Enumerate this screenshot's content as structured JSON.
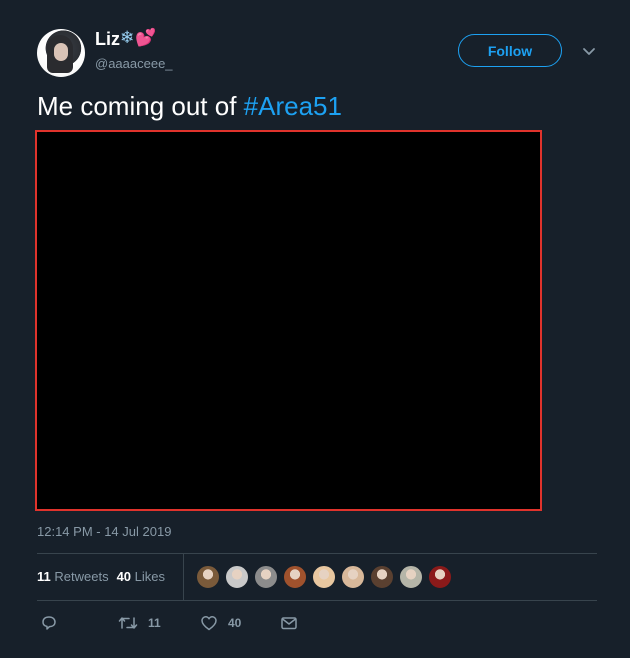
{
  "header": {
    "display_name": "Liz",
    "name_emoji": [
      "❄",
      "💕"
    ],
    "handle": "@aaaaceee_",
    "follow_label": "Follow"
  },
  "tweet": {
    "text_prefix": "Me coming out of ",
    "hashtag": "#Area51",
    "timestamp": "12:14 PM - 14 Jul 2019"
  },
  "stats": {
    "retweets_count": "11",
    "retweets_label": "Retweets",
    "likes_count": "40",
    "likes_label": "Likes"
  },
  "likers": [
    "#7a5a3a",
    "#c9c9c9",
    "#8c8c8c",
    "#a0522d",
    "#e8c7a0",
    "#d8b89a",
    "#5a4030",
    "#b5b5a8",
    "#8b1a1a"
  ],
  "actions": {
    "reply_count": "",
    "retweet_count": "11",
    "like_count": "40"
  },
  "colors": {
    "background": "#17202a",
    "accent": "#1da1f2",
    "muted_text": "#8899a6",
    "media_border": "#e0332c"
  }
}
